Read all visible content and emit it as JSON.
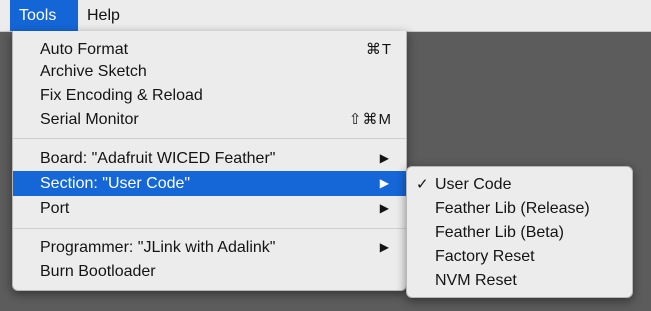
{
  "menubar": {
    "items": [
      "Tools",
      "Help"
    ]
  },
  "tools_menu": {
    "items": [
      {
        "label": "Auto Format",
        "shortcut": "⌘T"
      },
      {
        "label": "Archive Sketch"
      },
      {
        "label": "Fix Encoding & Reload"
      },
      {
        "label": "Serial Monitor",
        "shortcut": "⇧⌘M"
      },
      {
        "label": "Board: \"Adafruit WICED Feather\"",
        "submenu_arrow": "▶"
      },
      {
        "label": "Section: \"User Code\"",
        "submenu_arrow": "▶",
        "highlighted": true
      },
      {
        "label": "Port",
        "submenu_arrow": "▶"
      },
      {
        "label": "Programmer: \"JLink with Adalink\"",
        "submenu_arrow": "▶"
      },
      {
        "label": "Burn Bootloader"
      }
    ]
  },
  "section_submenu": {
    "items": [
      {
        "label": "User Code",
        "checked": true,
        "check_mark": "✓"
      },
      {
        "label": "Feather Lib (Release)"
      },
      {
        "label": "Feather Lib (Beta)"
      },
      {
        "label": "Factory Reset"
      },
      {
        "label": "NVM Reset"
      }
    ]
  },
  "colors": {
    "highlight": "#1567d8",
    "menu_background": "#ececec",
    "desktop_background": "#5c5c5c"
  }
}
